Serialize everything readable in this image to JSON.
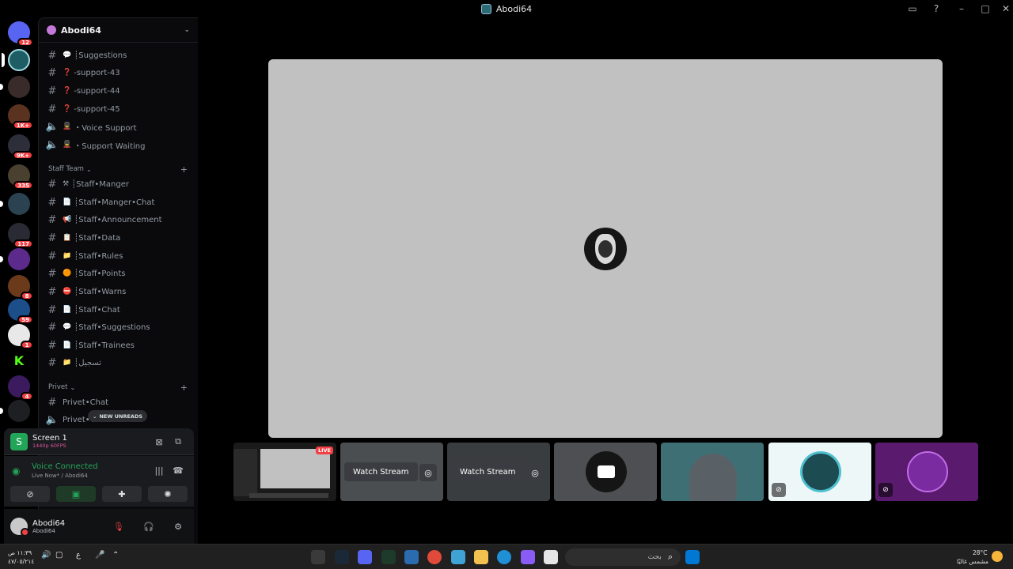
{
  "window": {
    "title": "Abodi64"
  },
  "server_badges": [
    "12",
    "1K+",
    "9K+",
    "335",
    "117",
    "8",
    "59",
    "1",
    "4"
  ],
  "guild": {
    "name": "Abodi64"
  },
  "channels_top": [
    {
      "emoji": "💬",
      "label": "┊Suggestions"
    },
    {
      "emoji": "❓",
      "label": "-support-43"
    },
    {
      "emoji": "❓",
      "label": "-support-44"
    },
    {
      "emoji": "❓",
      "label": "-support-45"
    },
    {
      "emoji": "💂",
      "label": "・Voice Support",
      "voice": true
    },
    {
      "emoji": "💂",
      "label": "・Support Waiting",
      "voice": true
    }
  ],
  "category_staff": "Staff Team",
  "channels_staff": [
    {
      "emoji": "⚒",
      "label": "┊Staff•Manger"
    },
    {
      "emoji": "📄",
      "label": "┊Staff•Manger•Chat"
    },
    {
      "emoji": "📢",
      "label": "┊Staff•Announcement"
    },
    {
      "emoji": "📋",
      "label": "┊Staff•Data"
    },
    {
      "emoji": "📁",
      "label": "┊Staff•Rules"
    },
    {
      "emoji": "🟠",
      "label": "┊Staff•Points"
    },
    {
      "emoji": "⛔",
      "label": "┊Staff•Warns"
    },
    {
      "emoji": "📄",
      "label": "┊Staff•Chat"
    },
    {
      "emoji": "💬",
      "label": "┊Staff•Suggestions"
    },
    {
      "emoji": "📄",
      "label": "┊Staff•Trainees"
    },
    {
      "emoji": "📁",
      "label": "┊تسجيل"
    }
  ],
  "category_privet": "Privet",
  "channels_privet": [
    {
      "label": "Privet•Chat"
    },
    {
      "label": "Privet•Voice",
      "voice": true
    }
  ],
  "new_unreads": "NEW UNREADS",
  "screen_panel": {
    "title": "Screen 1",
    "quality": "1440p 60FPS"
  },
  "voice_panel": {
    "status": "Voice Connected",
    "sub": "Live Now* / Abodi64"
  },
  "user_panel": {
    "name": "Abodi64",
    "sub": "Abodi64"
  },
  "tiles": {
    "live_label": "LIVE",
    "watch_label": "Watch Stream"
  },
  "taskbar": {
    "search_placeholder": "بحث",
    "time": "١١:٣٩ ص",
    "date": "٤٧/٠٥/٢١٤",
    "lang": "ع",
    "weather_temp": "28°C",
    "weather_text": "مشمس غالبًا"
  },
  "colors": {
    "accent_green": "#23a559",
    "badge_red": "#f23f43",
    "live_pink": "#e056a4"
  }
}
